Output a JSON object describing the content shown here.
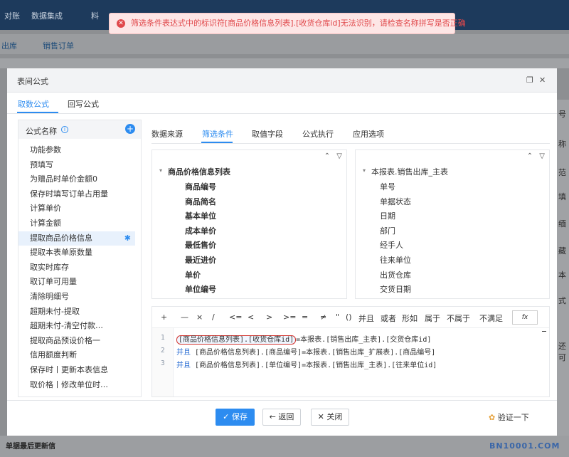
{
  "background": {
    "nav": [
      "对账",
      "数据集成",
      "料"
    ],
    "tabs": [
      "出库",
      "销售订单"
    ],
    "right_edge_chars": [
      "号",
      "称",
      "范",
      "填",
      "缅",
      "藏",
      "本",
      "式",
      "还可"
    ],
    "bottom_label": "单据最后更新信"
  },
  "toast": {
    "message": "筛选条件表达式中的标识符[商品价格信息列表].[收货仓库id]无法识别，请检查名称拼写是否正确",
    "close": "×",
    "icon_glyph": "✕"
  },
  "modal": {
    "title": "表间公式",
    "win_icons": [
      "❐",
      "✕"
    ],
    "tabs": [
      "取数公式",
      "回写公式"
    ],
    "left": {
      "header": "公式名称",
      "info_glyph": "i",
      "add_glyph": "+",
      "gear_glyph": "✱",
      "items": [
        "功能参数",
        "预填写",
        "为赠品时单价金额0",
        "保存时填写订单占用量",
        "计算单价",
        "计算金额",
        "提取商品价格信息",
        "提取本表单原数量",
        "取实时库存",
        "取订单可用量",
        "清除明细号",
        "超期未付-提取",
        "超期未付-清空付款…",
        "提取商品预设价格一",
        "信用额度判断",
        "保存时丨更新本表信息",
        "取价格丨修改单位时…"
      ],
      "selected_index": 6
    },
    "right_tabs": [
      "数据来源",
      "筛选条件",
      "取值字段",
      "公式执行",
      "应用选项"
    ],
    "right_tab_active": 1,
    "pane_tools": [
      "⌃",
      "▽"
    ],
    "left_pane": {
      "caret": "▾",
      "root": "商品价格信息列表",
      "items": [
        "商品编号",
        "商品简名",
        "基本单位",
        "成本单价",
        "最低售价",
        "最近进价",
        "单价",
        "单位编号"
      ]
    },
    "right_pane": {
      "caret": "▾",
      "root": "本报表.销售出库_主表",
      "items": [
        "单号",
        "单据状态",
        "日期",
        "部门",
        "经手人",
        "往来单位",
        "出货仓库",
        "交货日期"
      ]
    },
    "operators": [
      "+",
      "—",
      "×",
      "/",
      "<=",
      "<",
      ">",
      ">=",
      "=",
      "≠",
      "\"",
      "()",
      "并且",
      "或者",
      "形如",
      "属于",
      "不属于",
      "不满足"
    ],
    "fx": "fx",
    "code_lines": [
      {
        "num": "1",
        "kw": "",
        "highlight": "[商品价格信息列表].[收货仓库id]",
        "rest": "=本报表.[销售出库_主表].[交货仓库id]"
      },
      {
        "num": "2",
        "kw": "并且",
        "highlight": "",
        "rest": " [商品价格信息列表].[商品编号]=本报表.[销售出库_扩展表].[商品编号]"
      },
      {
        "num": "3",
        "kw": "并且",
        "highlight": "",
        "rest": " [商品价格信息列表].[单位编号]=本报表.[销售出库_主表].[往来单位id]"
      }
    ],
    "footer": {
      "save": "✓ 保存",
      "back": "← 返回",
      "close": "✕ 关闭",
      "verify_icon": "✿",
      "verify": "验证一下"
    }
  },
  "watermark": "BN10001.COM"
}
